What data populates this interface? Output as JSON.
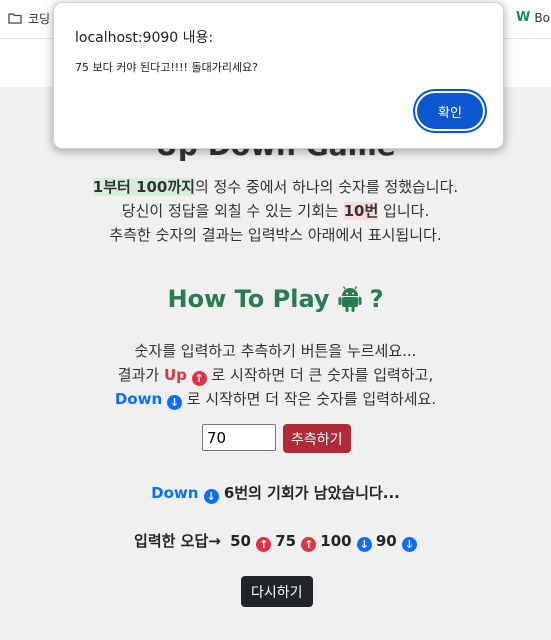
{
  "browser": {
    "bookmark_left": "코딩",
    "bookmark_right": "Bo"
  },
  "page": {
    "title_fragment": "Up Down Game",
    "intro_a1": "1부터 100까지",
    "intro_a2": "의 정수 중에서 하나의 숫자를 정했습니다.",
    "intro_b1": "당신이 정답을 외칠 수 있는 기회는 ",
    "intro_b2": "10번",
    "intro_b3": " 입니다.",
    "intro_c": "추측한 숫자의 결과는 입력박스 아래에서 표시됩니다.",
    "howto_title": "How To Play",
    "howto_q": "?",
    "rule_1": "숫자를 입력하고 추측하기 버튼을 누르세요...",
    "rule_2a": "결과가 ",
    "rule_2_up": "Up",
    "rule_2b": " 로 시작하면 더 큰 숫자를 입력하고,",
    "rule_3_down": "Down",
    "rule_3b": " 로 시작하면 더 작은 숫자를 입력하세요.",
    "guess_value": "70",
    "guess_button": "추측하기",
    "result_word": "Down",
    "result_text": "6번의 기회가 남았습니다...",
    "history_label": "입력한 오답→",
    "history": [
      {
        "value": "50",
        "dir": "up"
      },
      {
        "value": "75",
        "dir": "up"
      },
      {
        "value": "100",
        "dir": "down"
      },
      {
        "value": "90",
        "dir": "down"
      }
    ],
    "reset_button": "다시하기"
  },
  "alert": {
    "title": "localhost:9090 내용:",
    "message": "75 보다 커야 된다고!!!! 돌대가리세요?",
    "ok_button": "확인"
  },
  "colors": {
    "up": "#dc3545",
    "down": "#0d6efd",
    "howto": "#2a7a52",
    "guess_button": "#b02a37",
    "alert_button": "#0b57d0"
  }
}
